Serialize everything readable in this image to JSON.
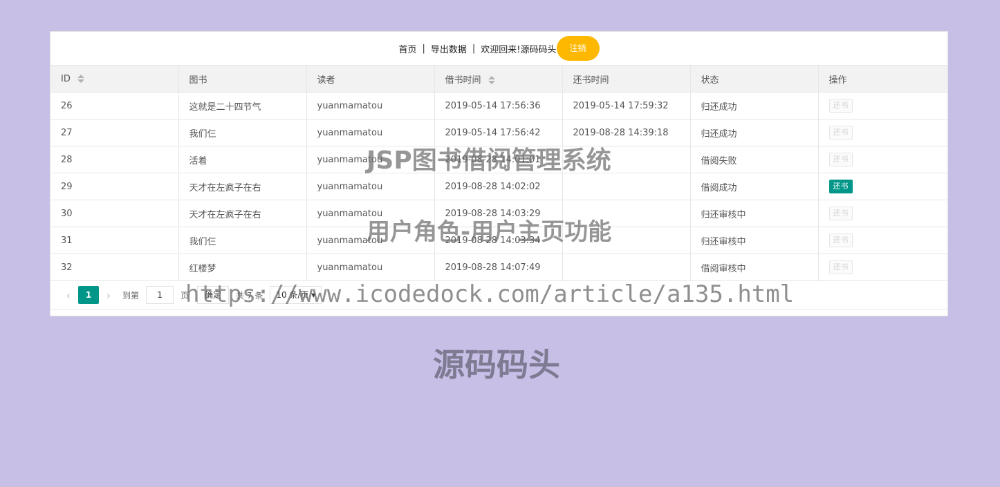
{
  "nav": {
    "home": "首页",
    "sep1": "|",
    "export": "导出数据",
    "sep2": "|",
    "welcome": "欢迎回来!",
    "username": "源码码头",
    "logout": "注销"
  },
  "table": {
    "headers": [
      "ID",
      "图书",
      "读者",
      "借书时间",
      "还书时间",
      "状态",
      "操作"
    ],
    "rows": [
      {
        "id": "26",
        "book": "这就是二十四节气",
        "reader": "yuanmamatou",
        "borrow": "2019-05-14 17:56:36",
        "return": "2019-05-14 17:59:32",
        "status": "归还成功",
        "action": "还书"
      },
      {
        "id": "27",
        "book": "我们仨",
        "reader": "yuanmamatou",
        "borrow": "2019-05-14 17:56:42",
        "return": "2019-08-28 14:39:18",
        "status": "归还成功",
        "action": "还书"
      },
      {
        "id": "28",
        "book": "活着",
        "reader": "yuanmamatou",
        "borrow": "2019-08-28 14:01:01",
        "return": "",
        "status": "借阅失败",
        "action": "还书"
      },
      {
        "id": "29",
        "book": "天才在左疯子在右",
        "reader": "yuanmamatou",
        "borrow": "2019-08-28 14:02:02",
        "return": "",
        "status": "借阅成功",
        "action": "还书"
      },
      {
        "id": "30",
        "book": "天才在左疯子在右",
        "reader": "yuanmamatou",
        "borrow": "2019-08-28 14:03:29",
        "return": "",
        "status": "归还审核中",
        "action": "还书"
      },
      {
        "id": "31",
        "book": "我们仨",
        "reader": "yuanmamatou",
        "borrow": "2019-08-28 14:03:34",
        "return": "",
        "status": "归还审核中",
        "action": "还书"
      },
      {
        "id": "32",
        "book": "红楼梦",
        "reader": "yuanmamatou",
        "borrow": "2019-08-28 14:07:49",
        "return": "",
        "status": "借阅审核中",
        "action": "还书"
      }
    ]
  },
  "pager": {
    "prev_icon": "chevron-left-icon",
    "next_icon": "chevron-right-icon",
    "current_page": "1",
    "goto_label": "到第",
    "goto_value": "1",
    "page_unit": "页",
    "confirm": "确定",
    "total": "共 7 条",
    "page_size": "10 条/页"
  },
  "watermarks": {
    "title": "JSP图书借阅管理系统",
    "subtitle": "用户角色-用户主页功能",
    "url": "https://www.icodedock.com/article/a135.html",
    "brand": "源码码头"
  },
  "colors": {
    "background": "#c8bfe7",
    "accent": "#009688",
    "logout": "#ffb800"
  }
}
